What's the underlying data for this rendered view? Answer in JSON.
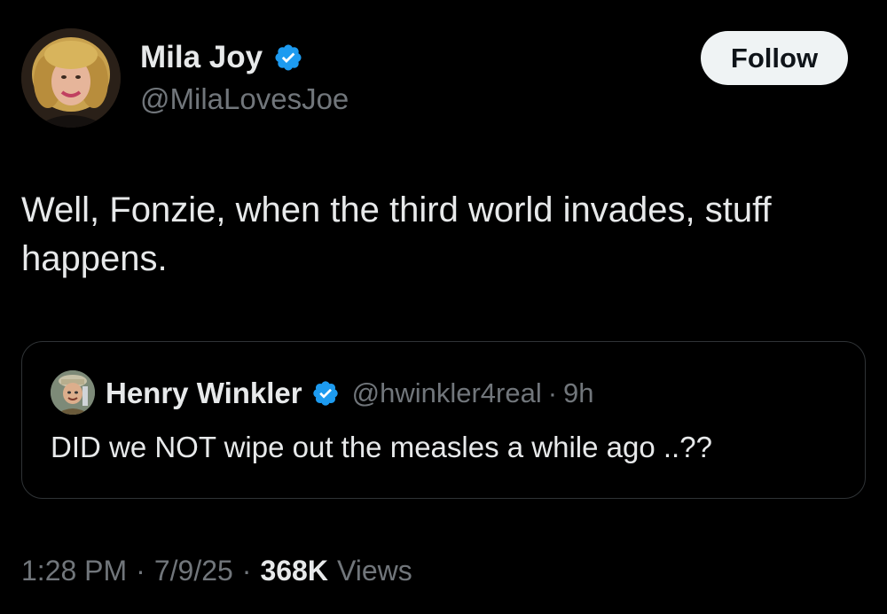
{
  "tweet": {
    "author": {
      "name": "Mila Joy",
      "handle": "@MilaLovesJoe",
      "verified": true,
      "avatar_icon": "profile-photo-woman-blonde"
    },
    "follow_button": "Follow",
    "text": "Well, Fonzie, when the third world invades, stuff happens.",
    "quoted": {
      "name": "Henry Winkler",
      "handle": "@hwinkler4real",
      "separator": "·",
      "time": "9h",
      "verified": true,
      "avatar_icon": "profile-photo-man-hat",
      "text": "DID we NOT wipe out the measles a while ago ..??"
    },
    "meta": {
      "time": "1:28 PM",
      "separator": "·",
      "date": "7/9/25",
      "separator2": "·",
      "views_count": "368K",
      "views_label": "Views"
    }
  },
  "colors": {
    "background": "#000000",
    "primary_text": "#e7e9ea",
    "secondary_text": "#71767b",
    "verified_blue": "#1d9bf0",
    "border": "#2f3336",
    "follow_bg": "#eff3f4"
  }
}
